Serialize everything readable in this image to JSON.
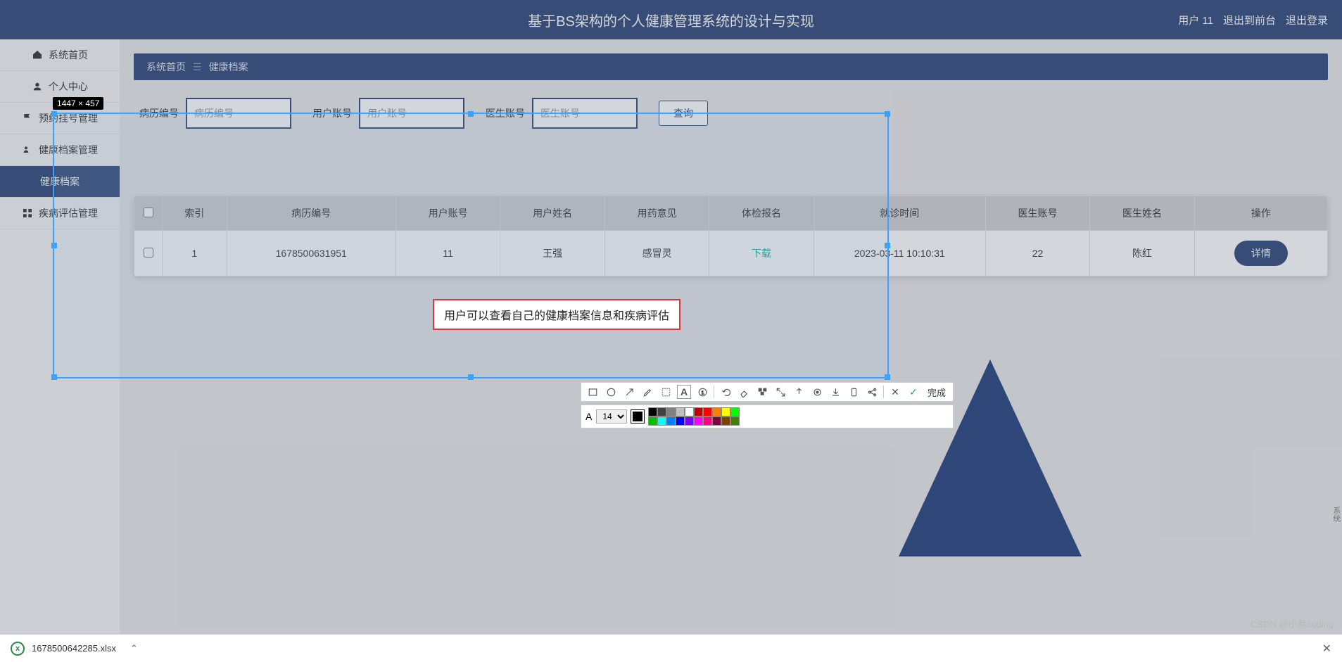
{
  "header": {
    "title": "基于BS架构的个人健康管理系统的设计与实现",
    "user_label": "用户 11",
    "logout_front": "退出到前台",
    "logout": "退出登录"
  },
  "sidebar": {
    "items": [
      {
        "label": "系统首页",
        "icon": "home"
      },
      {
        "label": "个人中心",
        "icon": "person"
      },
      {
        "label": "预约挂号管理",
        "icon": "flag"
      },
      {
        "label": "健康档案管理",
        "icon": "profile"
      },
      {
        "label": "健康档案",
        "icon": "",
        "active": true
      },
      {
        "label": "疾病评估管理",
        "icon": "grid"
      }
    ]
  },
  "breadcrumb": {
    "root": "系统首页",
    "current": "健康档案"
  },
  "search": {
    "f1_label": "病历编号",
    "f1_ph": "病历编号",
    "f2_label": "用户账号",
    "f2_ph": "用户账号",
    "f3_label": "医生账号",
    "f3_ph": "医生账号",
    "query_label": "查询"
  },
  "table": {
    "headers": [
      "",
      "索引",
      "病历编号",
      "用户账号",
      "用户姓名",
      "用药意见",
      "体检报名",
      "就诊时间",
      "医生账号",
      "医生姓名",
      "操作"
    ],
    "rows": [
      {
        "idx": "1",
        "rec_no": "1678500631951",
        "user_acct": "11",
        "user_name": "王强",
        "med": "感冒灵",
        "report": "下载",
        "time": "2023-03-11 10:10:31",
        "doc_acct": "22",
        "doc_name": "陈红",
        "action": "详情"
      }
    ]
  },
  "selection": {
    "dim_label": "1447 × 457"
  },
  "callout_text": "用户可以查看自己的健康档案信息和疾病评估",
  "toolbar": {
    "font_letter": "A",
    "font_size": "14",
    "done": "完成",
    "palette": [
      "#000000",
      "#404040",
      "#808080",
      "#c0c0c0",
      "#ffffff",
      "#c00000",
      "#ff0000",
      "#ff8000",
      "#ffff00",
      "#00ff00",
      "#00c000",
      "#00ffff",
      "#0080ff",
      "#0000ff",
      "#8000ff",
      "#ff00ff",
      "#ff0080",
      "#800040",
      "#804000",
      "#408000"
    ]
  },
  "download_bar": {
    "filename": "1678500642285.xlsx"
  },
  "watermark": "CSDN @小蔡coding",
  "side_text": "系统"
}
